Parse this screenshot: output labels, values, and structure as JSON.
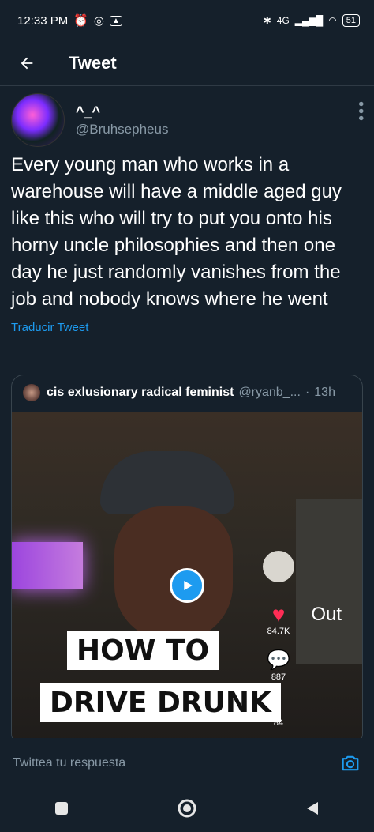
{
  "status_bar": {
    "time": "12:33 PM",
    "network": "4G",
    "battery": "51"
  },
  "header": {
    "title": "Tweet"
  },
  "tweet": {
    "display_name": "^_^",
    "handle": "@Bruhsepheus",
    "text": "Every young man who works in a warehouse will have a middle aged guy like this who will try to put you onto his  horny uncle philosophies and then one day he just randomly vanishes from the job and nobody knows where he went",
    "translate_label": "Traducir Tweet"
  },
  "quoted_tweet": {
    "display_name": "cis exlusionary radical feminist",
    "handle": "@ryanb_...",
    "separator": "·",
    "time": "13h",
    "media": {
      "caption_line1": "HOW TO",
      "caption_line2": "DRIVE DRUNK",
      "likes": "84.7K",
      "comments": "887",
      "partial_count": "84",
      "side_text": "Out"
    }
  },
  "reply_bar": {
    "placeholder": "Twittea tu respuesta"
  },
  "colors": {
    "background": "#15202b",
    "accent": "#1d9bf0",
    "secondary_text": "#8899a6",
    "divider": "#2f3a45"
  },
  "icons": {
    "back": "arrow-left-icon",
    "more": "more-vertical-icon",
    "play": "play-icon",
    "camera": "camera-icon",
    "nav_recent": "square-icon",
    "nav_home": "circle-icon",
    "nav_back": "triangle-back-icon"
  }
}
